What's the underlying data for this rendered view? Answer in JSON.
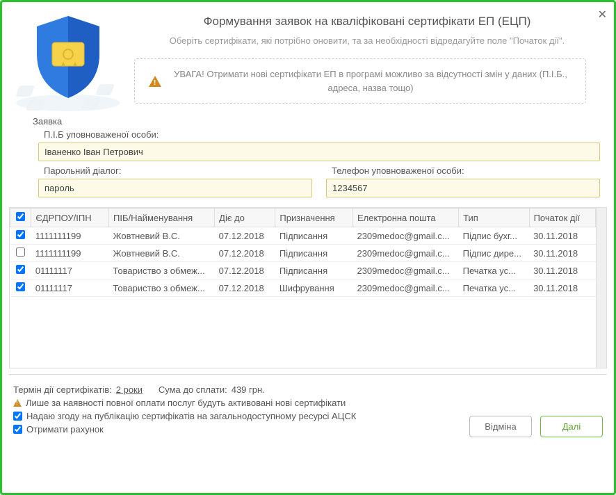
{
  "header": {
    "title": "Формування заявок на кваліфіковані сертифікати ЕП (ЕЦП)",
    "subtitle": "Оберіть сертифікати, які потрібно оновити, та за необхідності відредагуйте поле \"Початок дії\".",
    "warning": "УВАГА! Отримати нові сертифікати ЕП в програмі можливо за відсутності змін у даних (П.І.Б., адреса, назва тощо)"
  },
  "form": {
    "group_label": "Заявка",
    "pib_label": "П.І.Б уповноваженої особи:",
    "pib_value": "Іваненко Іван Петрович",
    "dialog_label": "Парольний діалог:",
    "dialog_value": "пароль",
    "phone_label": "Телефон уповноваженої особи:",
    "phone_value": "1234567"
  },
  "table": {
    "headers": {
      "edrpou": "ЄДРПОУ/ІПН",
      "pib": "ПІБ/Найменування",
      "until": "Діє до",
      "purpose": "Призначення",
      "email": "Електронна пошта",
      "type": "Тип",
      "start": "Початок дії"
    },
    "rows": [
      {
        "checked": true,
        "edrpou": "1111111199",
        "pib": "Жовтневий В.С.",
        "until": "07.12.2018",
        "purpose": "Підписання",
        "email": "2309medoc@gmail.c...",
        "type": "Підпис бухг...",
        "start": "30.11.2018"
      },
      {
        "checked": false,
        "edrpou": "1111111199",
        "pib": "Жовтневий В.С.",
        "until": "07.12.2018",
        "purpose": "Підписання",
        "email": "2309medoc@gmail.c...",
        "type": "Підпис дире...",
        "start": "30.11.2018"
      },
      {
        "checked": true,
        "edrpou": "01111117",
        "pib": "Товариство з обмеж...",
        "until": "07.12.2018",
        "purpose": "Підписання",
        "email": "2309medoc@gmail.c...",
        "type": "Печатка ус...",
        "start": "30.11.2018"
      },
      {
        "checked": true,
        "edrpou": "01111117",
        "pib": "Товариство з обмеж...",
        "until": "07.12.2018",
        "purpose": "Шифрування",
        "email": "2309medoc@gmail.c...",
        "type": "Печатка ус...",
        "start": "30.11.2018"
      }
    ]
  },
  "footer": {
    "term_prefix": "Термін дії сертифікатів:",
    "term_value": "2 роки",
    "sum_prefix": "Сума до сплати:",
    "sum_value": "439 грн.",
    "payment_notice": "Лише за наявності повної оплати послуг будуть активовані нові сертифікати",
    "consent_publish": "Надаю згоду на публікацію сертифікатів на загальнодоступному ресурсі АЦСК",
    "get_invoice": "Отримати рахунок",
    "cancel": "Відміна",
    "next": "Далі"
  }
}
